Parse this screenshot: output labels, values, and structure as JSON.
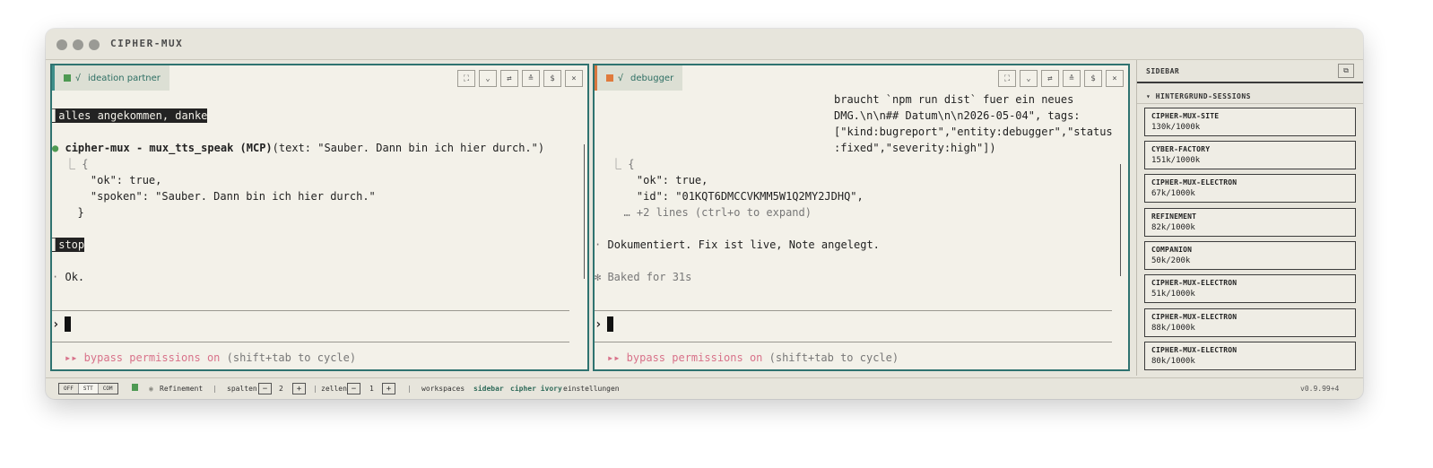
{
  "app": {
    "title": "CIPHER-MUX",
    "version": "v0.9.99+4"
  },
  "panes": {
    "left": {
      "name": "ideation partner",
      "lines": [
        "alles angekommen, danke",
        "cipher-mux - mux_tts_speak (MCP)",
        "(text: \"Sauber. Dann bin ich hier durch.\")",
        "⎿ {",
        "    \"ok\": true,",
        "    \"spoken\": \"Sauber. Dann bin ich hier durch.\"",
        "  }",
        "stop",
        "Ok."
      ],
      "prompt": "›",
      "footer_mode": "▸▸ bypass permissions on",
      "footer_hint": " (shift+tab to cycle)"
    },
    "right": {
      "name": "debugger",
      "lines": [
        "braucht `npm run dist` fuer ein neues",
        "DMG.\\n\\n## Datum\\n\\n2026-05-04\", tags:",
        "[\"kind:bugreport\",\"entity:debugger\",\"status",
        ":fixed\",\"severity:high\"])",
        "⎿ {",
        "    \"ok\": true,",
        "    \"id\": \"01KQT6DMCCVKMM5W1Q2MY2JDHQ\",",
        "  … +2 lines (ctrl+o to expand)",
        "Dokumentiert. Fix ist live, Note angelegt.",
        "✻ Baked for 31s"
      ],
      "prompt": "›",
      "footer_mode": "▸▸ bypass permissions on",
      "footer_hint": " (shift+tab to cycle)"
    },
    "buttons": [
      "⛶",
      "⌄",
      "⇄",
      "≙",
      "$",
      "×"
    ]
  },
  "sidebar": {
    "title": "SIDEBAR",
    "collapse_glyph": "⧉",
    "section": "▾ HINTERGRUND-SESSIONS",
    "sessions": [
      {
        "name": "CIPHER-MUX-SITE",
        "usage": "130k/1000k"
      },
      {
        "name": "CYBER-FACTORY",
        "usage": "151k/1000k"
      },
      {
        "name": "CIPHER-MUX-ELECTRON",
        "usage": "67k/1000k"
      },
      {
        "name": "REFINEMENT",
        "usage": "82k/1000k"
      },
      {
        "name": "COMPANION",
        "usage": "50k/200k"
      },
      {
        "name": "CIPHER-MUX-ELECTRON",
        "usage": "51k/1000k"
      },
      {
        "name": "CIPHER-MUX-ELECTRON",
        "usage": "88k/1000k"
      },
      {
        "name": "CIPHER-MUX-ELECTRON",
        "usage": "80k/1000k"
      }
    ]
  },
  "statusbar": {
    "modes": [
      "OFF",
      "STT",
      "COM"
    ],
    "session": "Refinement",
    "spalten_label": "spalten",
    "spalten_value": "2",
    "zellen_label": "zellen",
    "zellen_value": "1",
    "minus": "−",
    "plus": "+",
    "sep": "|",
    "links": [
      "workspaces",
      "sidebar",
      "cipher ivory",
      "einstellungen"
    ]
  },
  "colors": {
    "accent_teal": "#2f7370",
    "left_tab_square": "#4e9a53",
    "right_tab_square": "#e07a3c",
    "permissions_pink": "#d8728a"
  }
}
